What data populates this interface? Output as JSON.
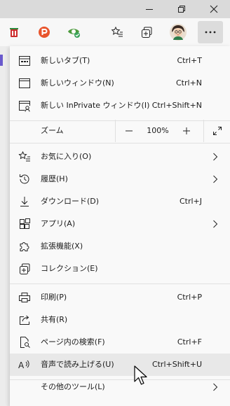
{
  "menu": {
    "items": [
      {
        "label": "新しいタブ(T)",
        "shortcut": "Ctrl+T"
      },
      {
        "label": "新しいウィンドウ(N)",
        "shortcut": "Ctrl+N"
      },
      {
        "label": "新しい InPrivate ウィンドウ(I)",
        "shortcut": "Ctrl+Shift+N"
      }
    ],
    "zoom": {
      "label": "ズーム",
      "minus": "—",
      "value": "100%",
      "plus": "+"
    },
    "items2": [
      {
        "label": "お気に入り(O)"
      },
      {
        "label": "履歴(H)"
      },
      {
        "label": "ダウンロード(D)",
        "shortcut": "Ctrl+J"
      },
      {
        "label": "アプリ(A)"
      },
      {
        "label": "拡張機能(X)"
      },
      {
        "label": "コレクション(E)"
      }
    ],
    "items3": [
      {
        "label": "印刷(P)",
        "shortcut": "Ctrl+P"
      },
      {
        "label": "共有(R)"
      },
      {
        "label": "ページ内の検索(F)",
        "shortcut": "Ctrl+F"
      },
      {
        "label": "音声で読み上げる(U)",
        "shortcut": "Ctrl+Shift+U"
      },
      {
        "label": "その他のツール(L)"
      }
    ]
  }
}
